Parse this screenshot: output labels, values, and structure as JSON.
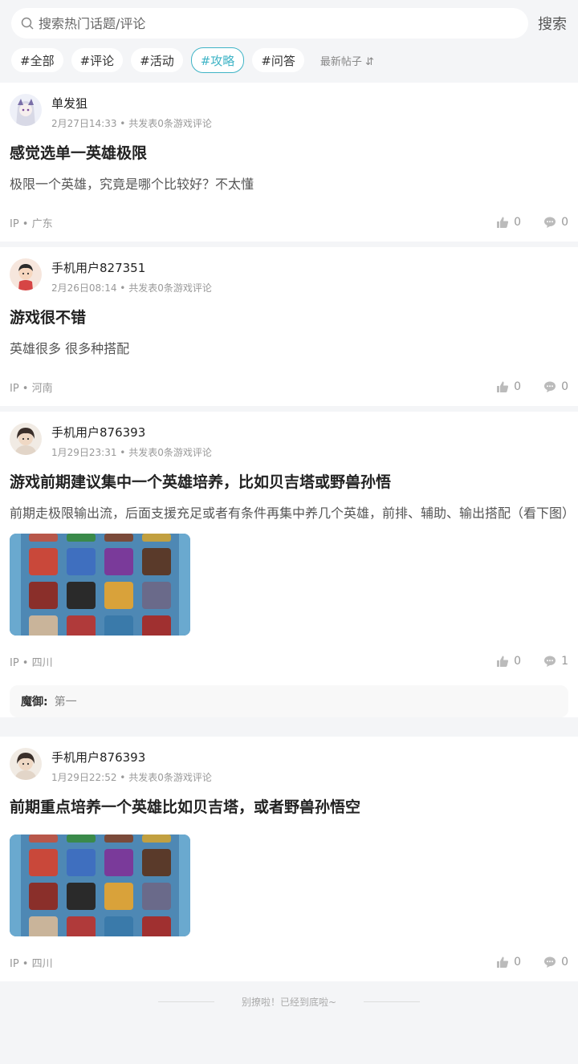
{
  "search": {
    "placeholder": "搜索热门话题/评论",
    "button": "搜索"
  },
  "tags": [
    "#全部",
    "#评论",
    "#活动",
    "#攻略",
    "#问答"
  ],
  "active_tag": "#攻略",
  "sort_label": "最新帖子 ⇵",
  "posts": [
    {
      "author": "单发狙",
      "time": "2月27日14:33 • 共发表0条游戏评论",
      "title": "感觉选单一英雄极限",
      "body": "极限一个英雄，究竟是哪个比较好？不太懂",
      "ip": "IP • 广东",
      "likes": "0",
      "comments": "0"
    },
    {
      "author": "手机用户827351",
      "time": "2月26日08:14 • 共发表0条游戏评论",
      "title": "游戏很不错",
      "body": "英雄很多 很多种搭配",
      "ip": "IP • 河南",
      "likes": "0",
      "comments": "0"
    },
    {
      "author": "手机用户876393",
      "time": "1月29日23:31 • 共发表0条游戏评论",
      "title": "游戏前期建议集中一个英雄培养，比如贝吉塔或野兽孙悟",
      "body": "前期走极限输出流，后面支援充足或者有条件再集中养几个英雄，前排、辅助、输出搭配（看下图）",
      "ip": "IP • 四川",
      "likes": "0",
      "comments": "1",
      "reply_user": "魔御:",
      "reply_text": "第一"
    },
    {
      "author": "手机用户876393",
      "time": "1月29日22:52 • 共发表0条游戏评论",
      "title": "前期重点培养一个英雄比如贝吉塔，或者野兽孙悟空",
      "ip": "IP • 四川",
      "likes": "0",
      "comments": "0"
    }
  ],
  "end_text": "别撩啦！已经到底啦~",
  "colors": {
    "accent": "#3fb4c6",
    "background": "#f4f5f7"
  }
}
